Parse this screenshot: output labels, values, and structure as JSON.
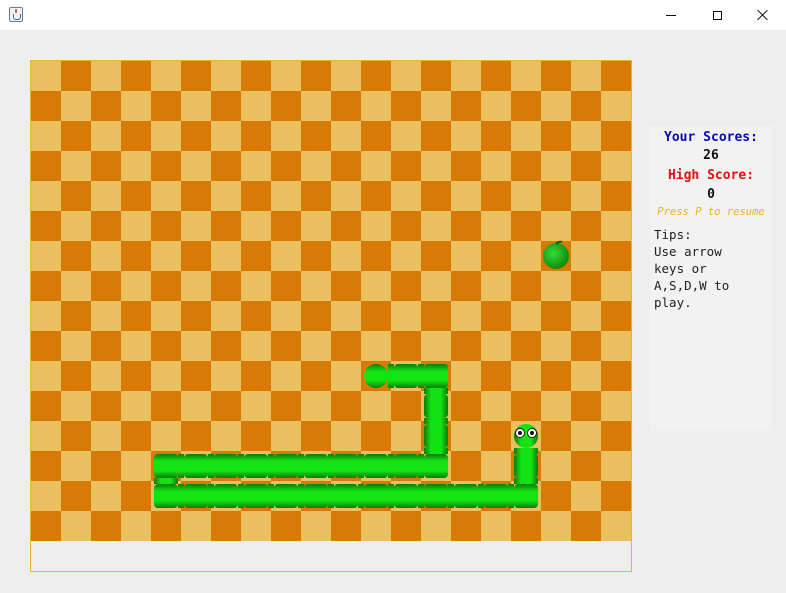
{
  "window": {
    "icon": "java-icon",
    "controls": [
      "minimize-icon",
      "maximize-icon",
      "close-icon"
    ]
  },
  "board": {
    "cols": 20,
    "rows": 16,
    "colors": {
      "light": "#e9bf60",
      "dark": "#d77a06",
      "border": "#e6b632"
    },
    "snake_color": "#13e313",
    "snake": [
      [
        16,
        12
      ],
      [
        16,
        13
      ],
      [
        16,
        14
      ],
      [
        15,
        14
      ],
      [
        14,
        14
      ],
      [
        13,
        14
      ],
      [
        12,
        14
      ],
      [
        11,
        14
      ],
      [
        10,
        14
      ],
      [
        9,
        14
      ],
      [
        8,
        14
      ],
      [
        7,
        14
      ],
      [
        6,
        14
      ],
      [
        5,
        14
      ],
      [
        4,
        14
      ],
      [
        4,
        13
      ],
      [
        5,
        13
      ],
      [
        6,
        13
      ],
      [
        7,
        13
      ],
      [
        8,
        13
      ],
      [
        9,
        13
      ],
      [
        10,
        13
      ],
      [
        11,
        13
      ],
      [
        12,
        13
      ],
      [
        13,
        13
      ],
      [
        13,
        12
      ],
      [
        13,
        11
      ],
      [
        13,
        10
      ],
      [
        12,
        10
      ],
      [
        11,
        10
      ]
    ],
    "apple": [
      17,
      6
    ],
    "apple_color": "#1fbf1f"
  },
  "panel": {
    "your_scores_label": "Your Scores:",
    "your_scores_value": "26",
    "high_score_label": "High Score:",
    "high_score_value": "0",
    "resume_hint": "Press P to resume",
    "tips": "Tips:\nUse arrow\nkeys or\nA,S,D,W to\nplay."
  }
}
